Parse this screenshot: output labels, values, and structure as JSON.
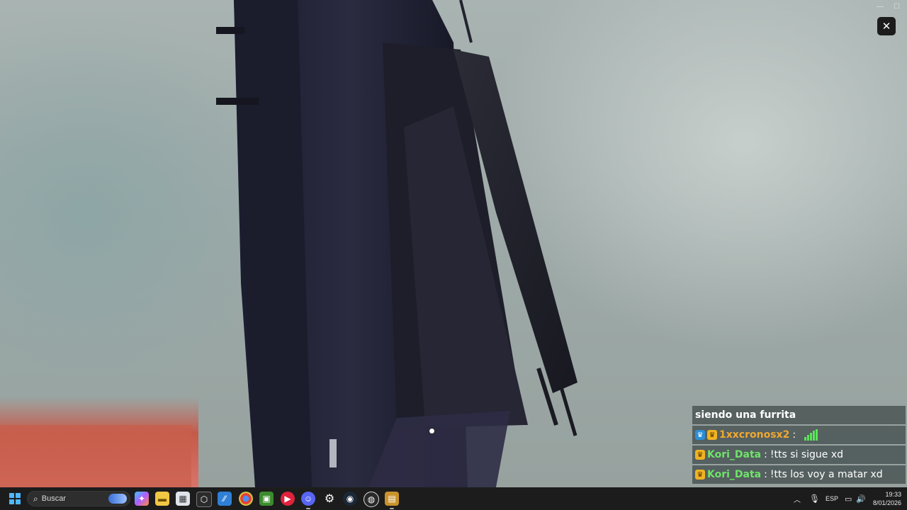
{
  "viewer": {
    "close_icon": "close-icon",
    "window_controls": [
      "minimize-icon",
      "maximize-icon"
    ]
  },
  "chat": {
    "messages": [
      {
        "user": "",
        "separator": "",
        "text": "siendo una furrita",
        "badges": []
      },
      {
        "user": "1xxcronosx2",
        "separator": ":",
        "text": "",
        "badges": [
          "prime-badge",
          "crown-badge"
        ],
        "user_color": "#f0a830",
        "cheer": true
      },
      {
        "user": "Kori_Data",
        "separator": ":",
        "text": "!tts si sigue xd",
        "badges": [
          "crown-badge"
        ],
        "user_color": "#6fe36a"
      },
      {
        "user": "Kori_Data",
        "separator": ":",
        "text": "!tts los voy a matar xd",
        "badges": [
          "crown-badge"
        ],
        "user_color": "#6fe36a"
      }
    ]
  },
  "taskbar": {
    "search_placeholder": "Buscar",
    "pinned_apps": [
      "copilot-icon",
      "file-explorer-icon",
      "store-icon",
      "app-icon",
      "vscode-icon",
      "chrome-icon",
      "minecraft-icon",
      "video-player-icon",
      "discord-icon",
      "settings-icon",
      "steam-icon",
      "obs-icon",
      "folder-icon"
    ],
    "tray": {
      "overflow_icon": "chevron-up-icon",
      "mic_icon": "microphone-icon",
      "language": "ESP",
      "network_icon": "network-icon",
      "volume_icon": "volume-icon"
    },
    "clock": {
      "time": "19:33",
      "date": "8/01/2026"
    }
  }
}
